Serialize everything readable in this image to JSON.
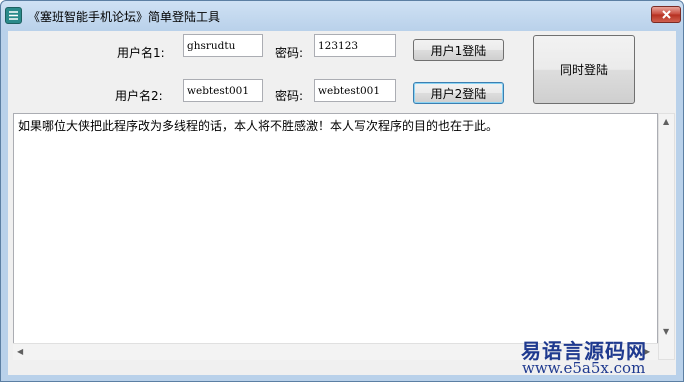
{
  "window": {
    "title": "《塞班智能手机论坛》简单登陆工具",
    "close_icon": "close-icon",
    "app_icon": "app-icon"
  },
  "form": {
    "user1_label": "用户名1:",
    "user1_value": "ghsrudtu",
    "pass1_label": "密码:",
    "pass1_value": "123123",
    "login1_button": "用户1登陆",
    "user2_label": "用户名2:",
    "user2_value": "webtest001",
    "pass2_label": "密码:",
    "pass2_value": "webtest001",
    "login2_button": "用户2登陆",
    "login_both_button": "同时登陆"
  },
  "log": {
    "text": "如果哪位大侠把此程序改为多线程的话，本人将不胜感激！本人写次程序的目的也在于此。"
  },
  "watermark": {
    "line1": "易语言源码网",
    "line2": "www.e5a5x.com"
  }
}
